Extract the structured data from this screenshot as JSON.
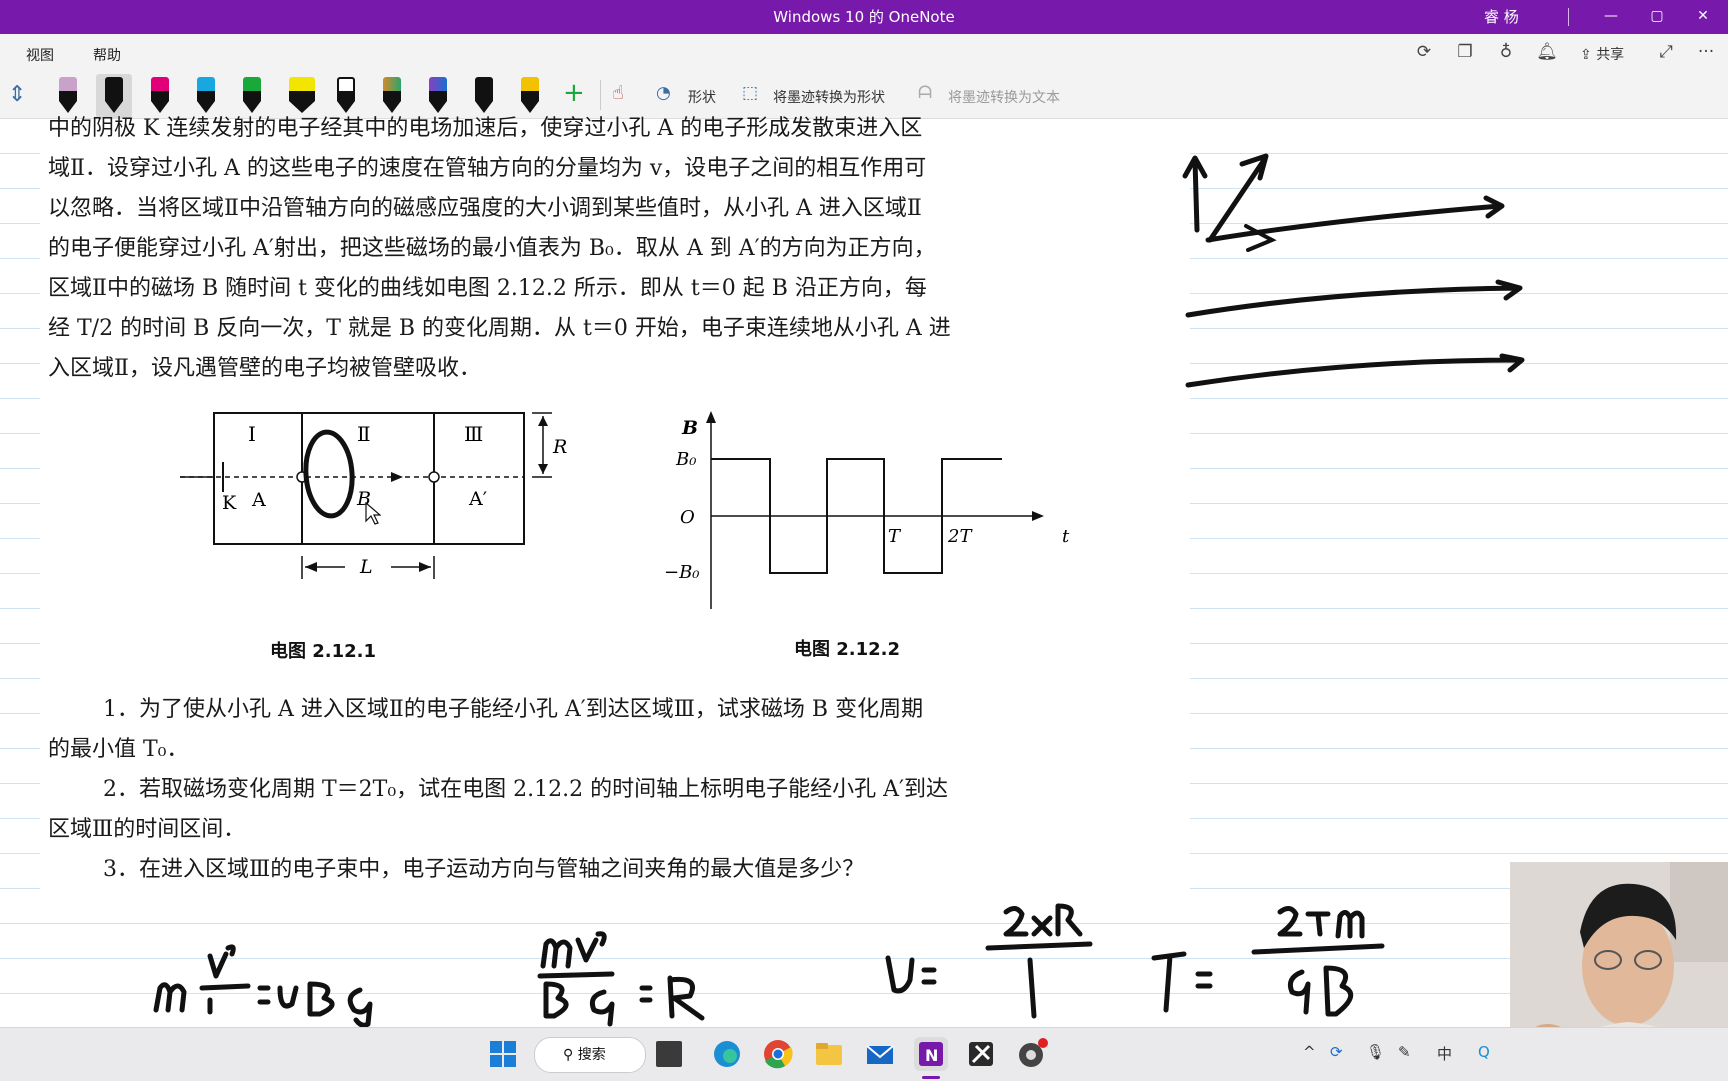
{
  "window": {
    "title": "Windows 10 的 OneNote",
    "user": "睿 杨",
    "minimize": "—",
    "maximize": "▢",
    "close": "✕"
  },
  "menu": {
    "view": "视图",
    "help": "帮助",
    "share": "共享",
    "more": "···"
  },
  "toolbar": {
    "shapes": "形状",
    "ink_to_shape": "将墨迹转换为形状",
    "ink_to_text": "将墨迹转换为文本",
    "pen_colors": [
      "#c8a2c8",
      "#111111",
      "#e0007a",
      "#19a7e0",
      "#19a93b",
      "#f2e600",
      "#111111",
      "#d48a2a",
      "#8a3fbf",
      "#111111",
      "#f2c200"
    ]
  },
  "problem": {
    "lines": [
      "中的阴极 K 连续发射的电子经其中的电场加速后，使穿过小孔 A 的电子形成发散束进入区",
      "域Ⅱ．设穿过小孔 A 的这些电子的速度在管轴方向的分量均为 v，设电子之间的相互作用可",
      "以忽略．当将区域Ⅱ中沿管轴方向的磁感应强度的大小调到某些值时，从小孔 A 进入区域Ⅱ",
      "的电子便能穿过小孔 A′射出，把这些磁场的最小值表为 B₀．取从 A 到 A′的方向为正方向，",
      "区域Ⅱ中的磁场 B 随时间 t 变化的曲线如电图 2.12.2 所示．即从 t＝0 起 B 沿正方向，每",
      "经 T/2 的时间 B 反向一次，T 就是 B 的变化周期．从 t＝0 开始，电子束连续地从小孔 A 进",
      "入区域Ⅱ，设凡遇管壁的电子均被管壁吸收．"
    ],
    "fig1": {
      "caption": "电图 2.12.1",
      "region1": "Ⅰ",
      "region2": "Ⅱ",
      "region3": "Ⅲ",
      "k": "K",
      "a": "A",
      "b": "B",
      "a_prime": "A′",
      "r": "R",
      "l": "L"
    },
    "fig2": {
      "caption": "电图 2.12.2",
      "y_axis": "B",
      "x_axis": "t",
      "b0": "B₀",
      "neg_b0": "−B₀",
      "origin": "O",
      "t1": "T",
      "t2": "2T"
    },
    "questions": [
      "1．为了使从小孔 A 进入区域Ⅱ的电子能经小孔 A′到达区域Ⅲ，试求磁场 B 变化周期",
      "的最小值 T₀．",
      "2．若取磁场变化周期 T＝2T₀，试在电图 2.12.2 的时间轴上标明电子能经小孔 A′到达",
      "区域Ⅲ的时间区间．",
      "3．在进入区域Ⅲ的电子束中，电子运动方向与管轴之间夹角的最大值是多少？"
    ]
  },
  "taskbar": {
    "search": "搜索",
    "ime": "中"
  }
}
